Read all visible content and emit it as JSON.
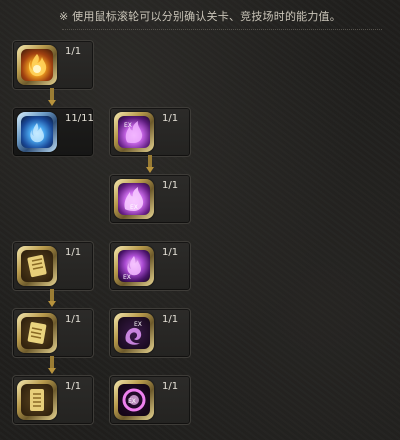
{
  "hint": "※ 使用鼠标滚轮可以分别确认关卡、竞技场时的能力值。",
  "skills": [
    {
      "level": "1/1",
      "icon": "fire-swirl-icon",
      "active": false
    },
    {
      "level": "11/11",
      "icon": "blue-flame-orb-icon",
      "active": true
    },
    {
      "level": "1/1",
      "icon": "purple-flame-ex-icon",
      "active": false
    },
    {
      "level": "1/1",
      "icon": "purple-flame-ex-2-icon",
      "active": false
    },
    {
      "level": "1/1",
      "icon": "golden-scroll-icon",
      "active": false
    },
    {
      "level": "1/1",
      "icon": "purple-orb-ex-icon",
      "active": false
    },
    {
      "level": "1/1",
      "icon": "golden-scroll-2-icon",
      "active": false
    },
    {
      "level": "1/1",
      "icon": "purple-ghost-ex-icon",
      "active": false
    },
    {
      "level": "1/1",
      "icon": "golden-scroll-3-icon",
      "active": false
    },
    {
      "level": "1/1",
      "icon": "purple-ring-ex-icon",
      "active": false
    }
  ],
  "colors": {
    "gold_frame": "#c9a94e",
    "connector": "#9a7c34",
    "text": "#e4e0d6"
  }
}
